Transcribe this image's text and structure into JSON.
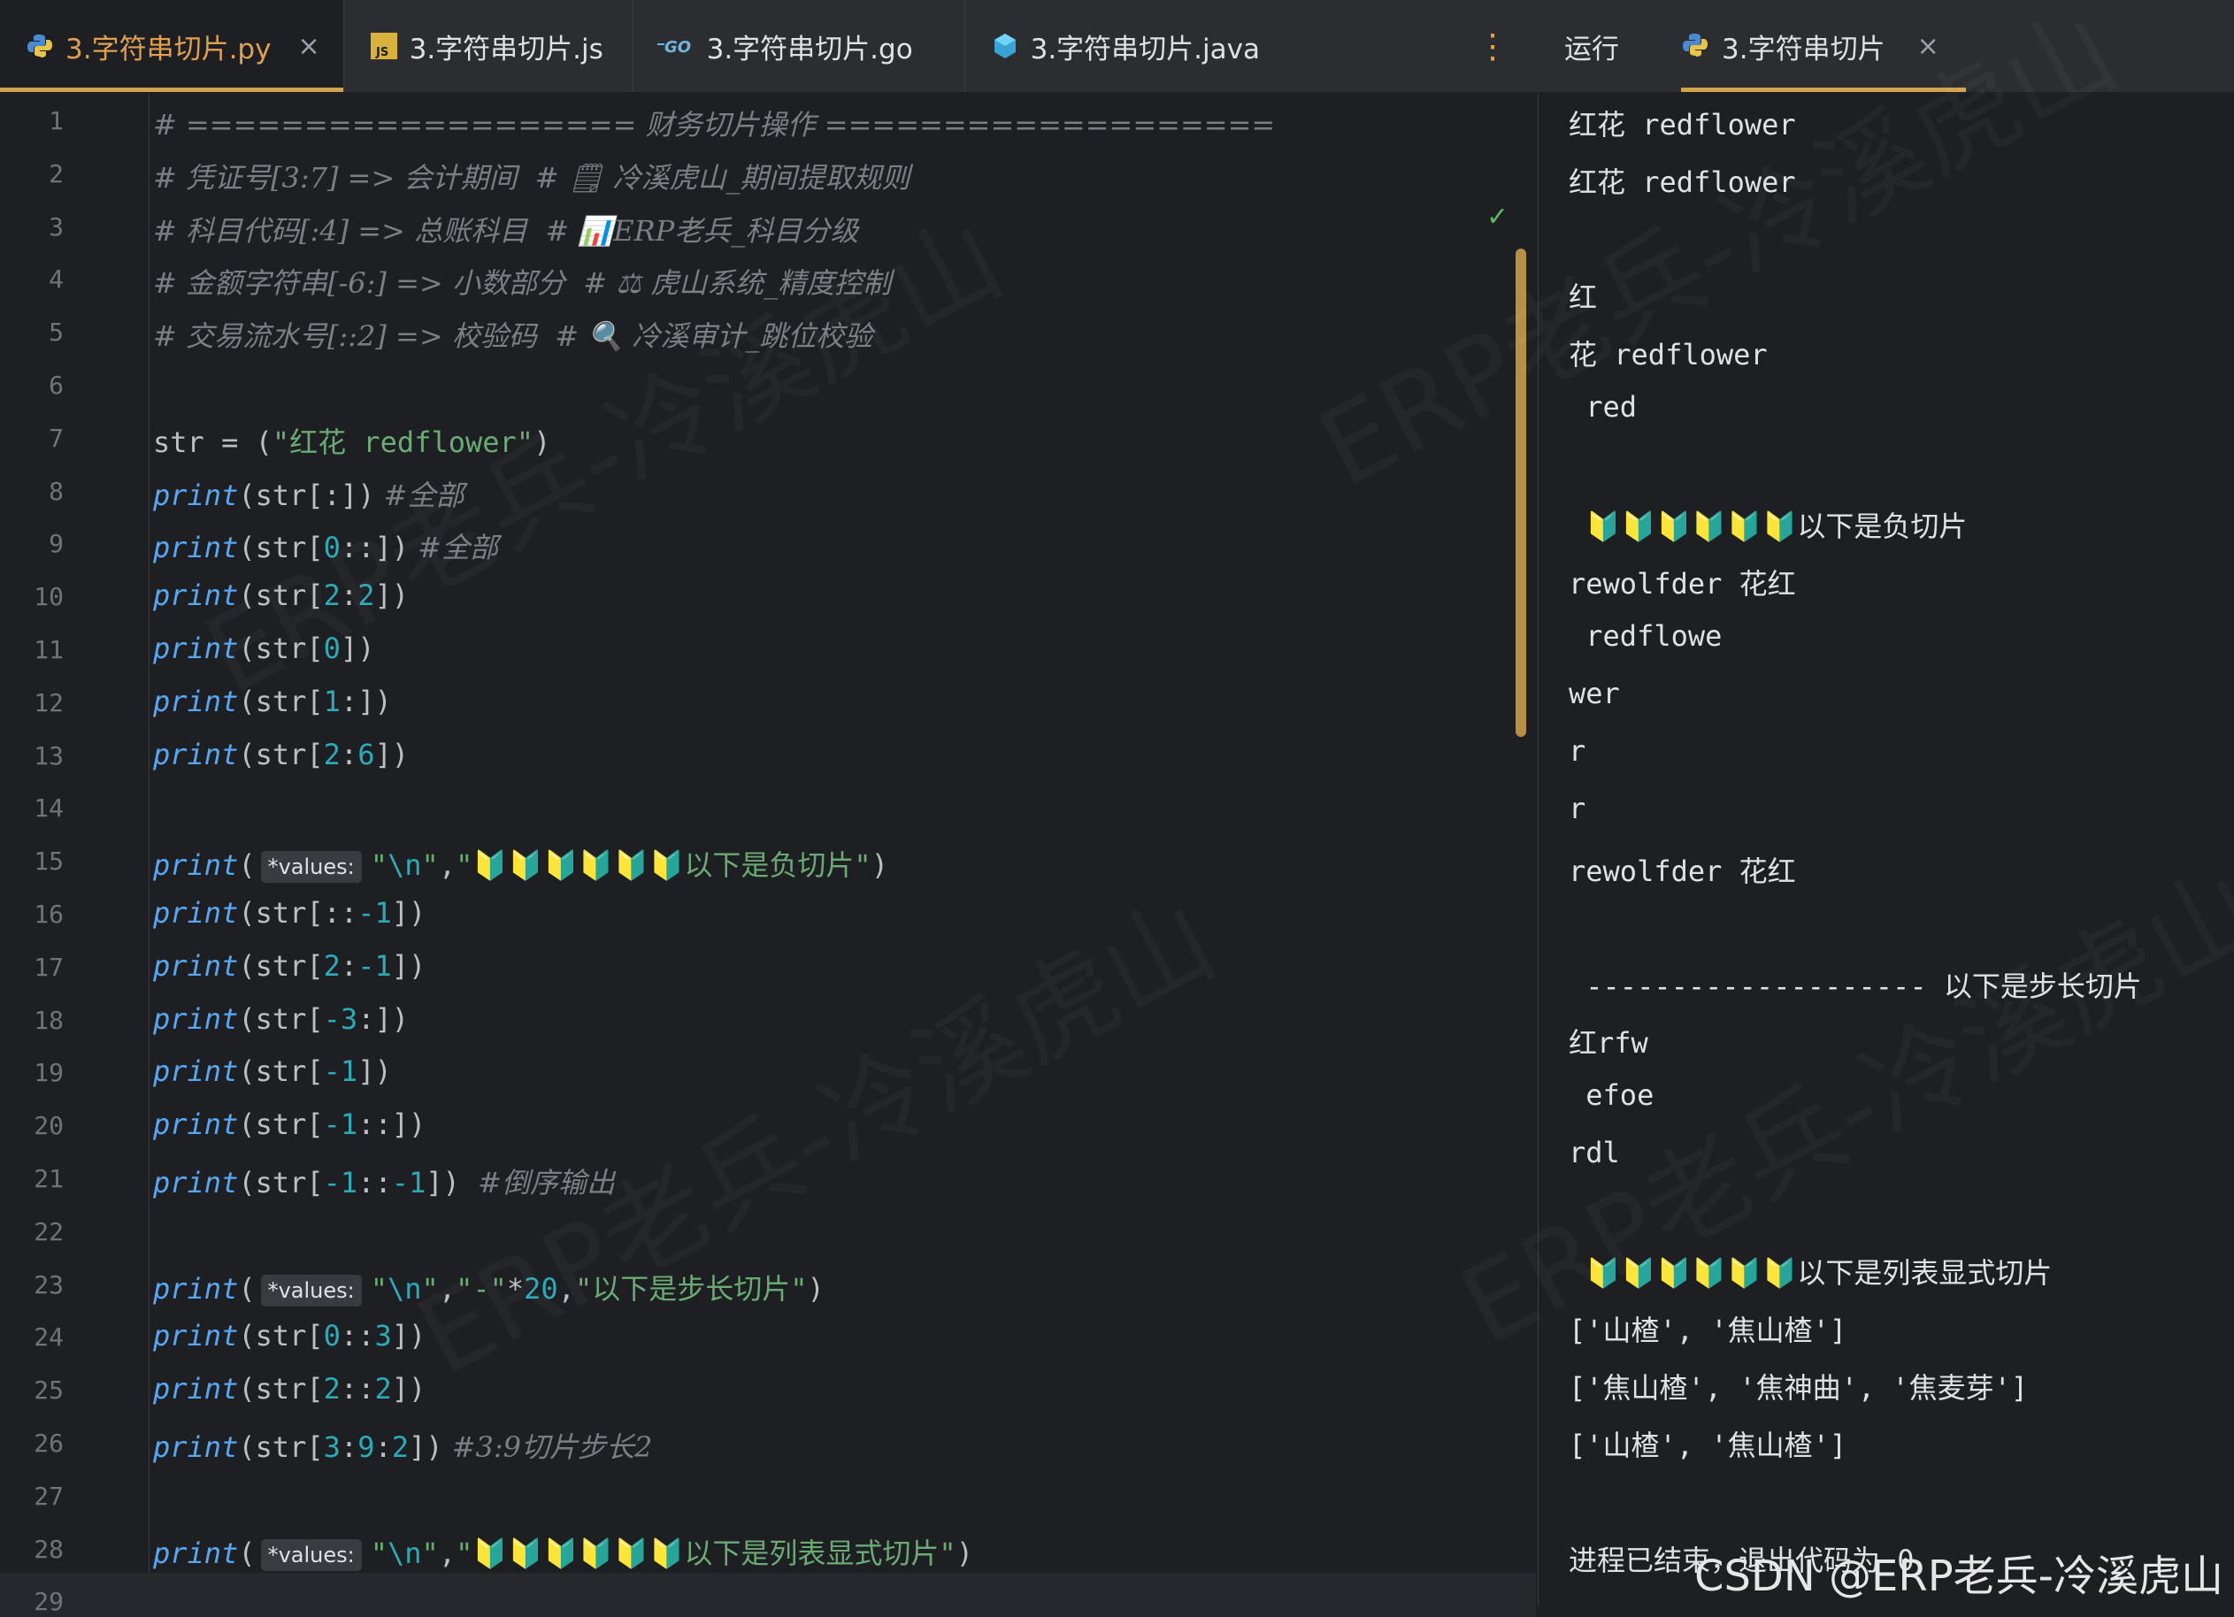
{
  "tabs": [
    {
      "label": "3.字符串切片.py",
      "icon": "python-icon",
      "active": true,
      "close": "×"
    },
    {
      "label": "3.字符串切片.js",
      "icon": "js-icon",
      "active": false
    },
    {
      "label": "3.字符串切片.go",
      "icon": "go-icon",
      "active": false
    },
    {
      "label": "3.字符串切片.java",
      "icon": "java-icon",
      "active": false
    }
  ],
  "tab_badges": {
    "js": "JS",
    "go": "GO"
  },
  "more": "⋮",
  "run": {
    "label": "运行",
    "tab": "3.字符串切片",
    "close": "×"
  },
  "editor": {
    "check": "✓",
    "lines": [
      {
        "n": "1",
        "t": "comment",
        "text": "# =================== 财务切片操作 ==================="
      },
      {
        "n": "2",
        "t": "comment",
        "text": "# 凭证号[3:7] => 会计期间  # 🗒 冷溪虎山_期间提取规则"
      },
      {
        "n": "3",
        "t": "comment",
        "text": "# 科目代码[:4] => 总账科目  # 📊ERP老兵_科目分级"
      },
      {
        "n": "4",
        "t": "comment",
        "text": "# 金额字符串[-6:] => 小数部分  # ⚖ 虎山系统_精度控制"
      },
      {
        "n": "5",
        "t": "comment",
        "text": "# 交易流水号[::2] => 校验码  # 🔍 冷溪审计_跳位校验"
      },
      {
        "n": "6",
        "t": "blank",
        "text": ""
      },
      {
        "n": "7",
        "t": "assign",
        "var": "str",
        "eq": " = ",
        "pre": "(",
        "s": "\"红花 redflower\"",
        "post": ")"
      },
      {
        "n": "8",
        "t": "print",
        "arg": "str[:]",
        "c": " #全部"
      },
      {
        "n": "9",
        "t": "print",
        "arg": "str[0::]",
        "c": " #全部"
      },
      {
        "n": "10",
        "t": "print",
        "arg": "str[2:2]",
        "c": ""
      },
      {
        "n": "11",
        "t": "print",
        "arg": "str[0]",
        "c": ""
      },
      {
        "n": "12",
        "t": "print",
        "arg": "str[1:]",
        "c": ""
      },
      {
        "n": "13",
        "t": "print",
        "arg": "str[2:6]",
        "c": ""
      },
      {
        "n": "14",
        "t": "blank",
        "text": ""
      },
      {
        "n": "15",
        "t": "printv",
        "hint": "*values:",
        "args": "\"\\n\",\"🔰🔰🔰🔰🔰🔰以下是负切片\""
      },
      {
        "n": "16",
        "t": "print",
        "arg": "str[::-1]",
        "c": ""
      },
      {
        "n": "17",
        "t": "print",
        "arg": "str[2:-1]",
        "c": ""
      },
      {
        "n": "18",
        "t": "print",
        "arg": "str[-3:]",
        "c": ""
      },
      {
        "n": "19",
        "t": "print",
        "arg": "str[-1]",
        "c": ""
      },
      {
        "n": "20",
        "t": "print",
        "arg": "str[-1::]",
        "c": ""
      },
      {
        "n": "21",
        "t": "print",
        "arg": "str[-1::-1]",
        "c": "  #倒序输出"
      },
      {
        "n": "22",
        "t": "blank",
        "text": ""
      },
      {
        "n": "23",
        "t": "printv",
        "hint": "*values:",
        "args": "\"\\n\",\"-\"*20,\"以下是步长切片\""
      },
      {
        "n": "24",
        "t": "print",
        "arg": "str[0::3]",
        "c": ""
      },
      {
        "n": "25",
        "t": "print",
        "arg": "str[2::2]",
        "c": ""
      },
      {
        "n": "26",
        "t": "print",
        "arg": "str[3:9:2]",
        "c": " #3:9切片步长2"
      },
      {
        "n": "27",
        "t": "blank",
        "text": ""
      },
      {
        "n": "28",
        "t": "printv",
        "hint": "*values:",
        "args": "\"\\n\",\"🔰🔰🔰🔰🔰🔰以下是列表显式切片\""
      },
      {
        "n": "29",
        "t": "blank",
        "text": ""
      }
    ],
    "print_kw": "print"
  },
  "console": {
    "lines": [
      "红花 redflower",
      "红花 redflower",
      "",
      "红",
      "花 redflower",
      " red",
      "",
      " 🔰🔰🔰🔰🔰🔰以下是负切片",
      "rewolfder 花红",
      " redflowe",
      "wer",
      "r",
      "r",
      "rewolfder 花红",
      "",
      " -------------------- 以下是步长切片",
      "红rfw",
      " efoe",
      "rdl",
      "",
      " 🔰🔰🔰🔰🔰🔰以下是列表显式切片",
      "['山楂', '焦山楂']",
      "['焦山楂', '焦神曲', '焦麦芽']",
      "['山楂', '焦山楂']",
      "",
      "进程已结束，退出代码为 0"
    ]
  },
  "watermark_text": "CSDN @ERP老兵-冷溪虎山",
  "bg_watermark": "ERP老兵-冷溪虎山",
  "colors": {
    "accent": "#d4a24a",
    "bg": "#1e1f22",
    "comment": "#7a7e85",
    "function": "#56a8f5",
    "number": "#2aacb8",
    "string": "#6aab73"
  }
}
